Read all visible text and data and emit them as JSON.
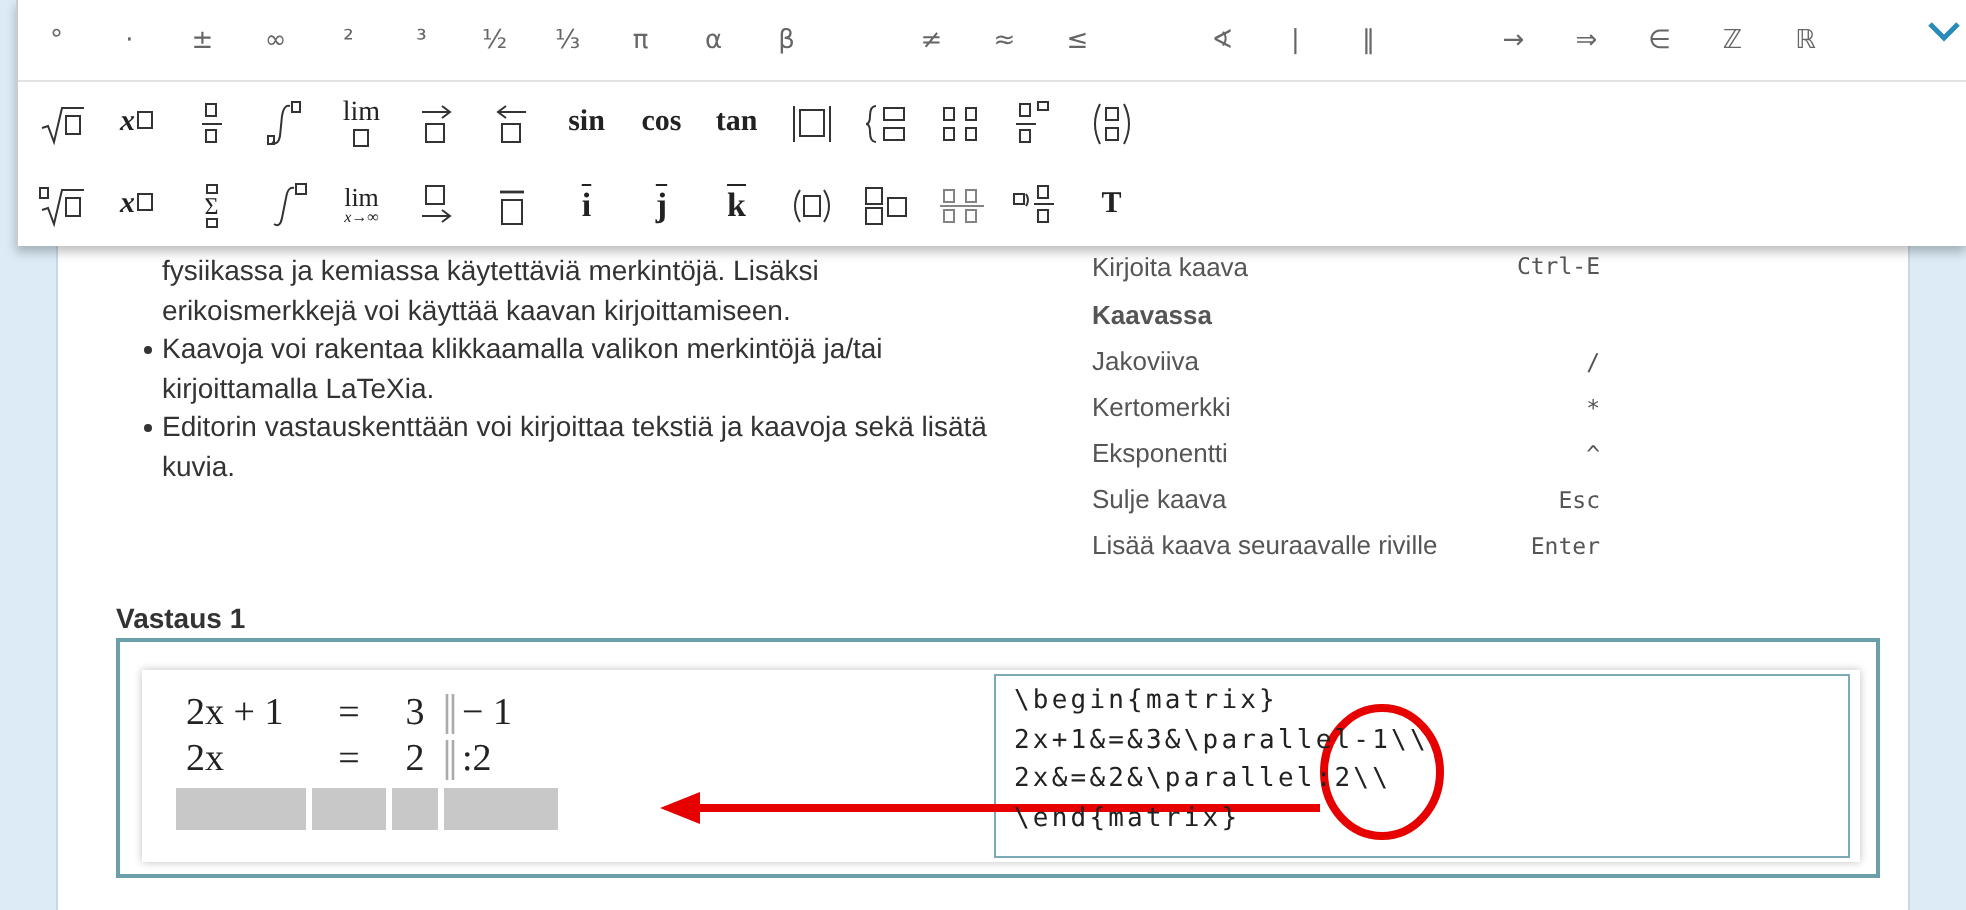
{
  "toolbar": {
    "symbol_groups": [
      [
        "°",
        "·",
        "±",
        "∞",
        "²",
        "³",
        "½",
        "⅓",
        "π",
        "α",
        "β"
      ],
      [
        "≠",
        "≈",
        "≤"
      ],
      [
        "∢",
        "|",
        "‖"
      ],
      [
        "→",
        "⇒",
        "∈",
        "ℤ",
        "ℝ"
      ]
    ],
    "template_rows": [
      [
        {
          "kind": "sqrt"
        },
        {
          "kind": "power",
          "label": "x"
        },
        {
          "kind": "fraction"
        },
        {
          "kind": "integral"
        },
        {
          "kind": "over-box",
          "label": "lim"
        },
        {
          "kind": "vec-right"
        },
        {
          "kind": "vec-left"
        },
        {
          "kind": "word",
          "label": "sin"
        },
        {
          "kind": "word",
          "label": "cos"
        },
        {
          "kind": "word",
          "label": "tan"
        },
        {
          "kind": "abs"
        },
        {
          "kind": "cases"
        },
        {
          "kind": "matrix"
        },
        {
          "kind": "frac-sup"
        },
        {
          "kind": "binom"
        }
      ],
      [
        {
          "kind": "nthroot"
        },
        {
          "kind": "subscript",
          "label": "x"
        },
        {
          "kind": "sigma",
          "label": "Σ"
        },
        {
          "kind": "integral-limits"
        },
        {
          "kind": "limit",
          "label": "lim",
          "sub": "x→∞"
        },
        {
          "kind": "arrow-under"
        },
        {
          "kind": "bar-box"
        },
        {
          "kind": "bar",
          "label": "i"
        },
        {
          "kind": "bar",
          "label": "j"
        },
        {
          "kind": "bar",
          "label": "k"
        },
        {
          "kind": "paren-box"
        },
        {
          "kind": "two-boxes"
        },
        {
          "kind": "matrix-lines"
        },
        {
          "kind": "mixed"
        },
        {
          "kind": "word",
          "label": "T"
        }
      ]
    ]
  },
  "instructions": {
    "bullets": [
      {
        "text": "fysiikassa ja kemiassa käytettäviä merkintöjä. Lisäksi erikoismerkkejä voi käyttää kaavan kirjoittamiseen.",
        "continued": true
      },
      {
        "text": "Kaavoja voi rakentaa klikkaamalla valikon merkintöjä ja/tai kirjoittamalla LaTeXia.",
        "continued": false
      },
      {
        "text": "Editorin vastauskenttään voi kirjoittaa tekstiä ja kaavoja sekä lisätä kuvia.",
        "continued": false
      }
    ],
    "shortcuts": [
      {
        "kind": "row",
        "label": "Kirjoita kaava",
        "key": "Ctrl-E"
      },
      {
        "kind": "heading",
        "label": "Kaavassa"
      },
      {
        "kind": "row",
        "label": "Jakoviiva",
        "key": "/"
      },
      {
        "kind": "row",
        "label": "Kertomerkki",
        "key": "*"
      },
      {
        "kind": "row",
        "label": "Eksponentti",
        "key": "^"
      },
      {
        "kind": "row",
        "label": "Sulje kaava",
        "key": "Esc"
      },
      {
        "kind": "row",
        "label": "Lisää kaava seuraavalle riville",
        "key": "Enter"
      }
    ]
  },
  "answer": {
    "title": "Vastaus 1",
    "math_rows": [
      {
        "kind": "equation",
        "lhs": "2x + 1",
        "relation": "=",
        "rhs": "3",
        "operation": "− 1"
      },
      {
        "kind": "equation",
        "lhs": "2x",
        "relation": "=",
        "rhs": "2",
        "operation": ":2"
      },
      {
        "kind": "placeholder"
      }
    ],
    "latex_lines": [
      "\\begin{matrix}",
      "2x+1&=&3&\\parallel-1\\\\",
      "2x&=&2&\\parallel:2\\\\",
      "\\end{matrix}"
    ]
  }
}
